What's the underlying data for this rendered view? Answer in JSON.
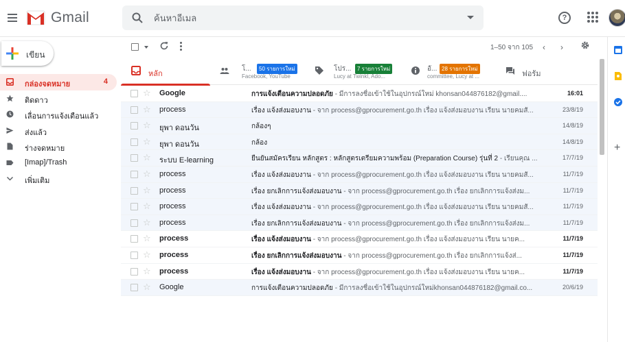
{
  "header": {
    "app_name": "Gmail",
    "search_placeholder": "ค้นหาอีเมล"
  },
  "compose": {
    "label": "เขียน"
  },
  "nav": {
    "items": [
      {
        "label": "กล่องจดหมาย",
        "count": "4",
        "icon": "inbox-icon",
        "active": true
      },
      {
        "label": "ติดดาว",
        "count": "",
        "icon": "star-icon"
      },
      {
        "label": "เลื่อนการแจ้งเตือนแล้ว",
        "count": "",
        "icon": "clock-icon"
      },
      {
        "label": "ส่งแล้ว",
        "count": "",
        "icon": "send-icon"
      },
      {
        "label": "ร่างจดหมาย",
        "count": "",
        "icon": "draft-icon"
      },
      {
        "label": "[Imap]/Trash",
        "count": "",
        "icon": "label-icon"
      },
      {
        "label": "เพิ่มเติม",
        "count": "",
        "icon": "chevron-down-icon"
      }
    ]
  },
  "toolbar": {
    "range": "1–50 จาก 105",
    "prev": "‹",
    "next": "›"
  },
  "tabs": {
    "primary": {
      "title": "หลัก"
    },
    "social": {
      "title": "โ...",
      "badge": "50 รายการใหม่",
      "sub": "Facebook, YouTube",
      "badge_color": "#1a73e8"
    },
    "promotions": {
      "title": "โปร...",
      "badge": "7 รายการใหม่",
      "sub": "Lucy at Twinkl, Ado...",
      "badge_color": "#188038"
    },
    "updates": {
      "title": "อั...",
      "badge": "28 รายการใหม่",
      "sub": "committee, Lucy at ...",
      "badge_color": "#e37400"
    },
    "forums": {
      "title": "ฟอรัม"
    }
  },
  "emails": [
    {
      "sender": "Google",
      "subject": "การแจ้งเตือนความปลอดภัย",
      "snippet": " - มีการลงชื่อเข้าใช้ในอุปกรณ์ใหม่ khonsan044876182@gmail....",
      "date": "16:01",
      "unread": true
    },
    {
      "sender": "process",
      "subject": "เรื่อง แจ้งส่งมอบงาน",
      "snippet": " - จาก process@gprocurement.go.th เรื่อง แจ้งส่งมอบงาน เรียน นายคมสั...",
      "date": "23/8/19",
      "unread": false
    },
    {
      "sender": "ยุพา ดอนวัน",
      "subject": "กล้องๆ",
      "snippet": "",
      "date": "14/8/19",
      "unread": false
    },
    {
      "sender": "ยุพา ดอนวัน",
      "subject": "กล้อง",
      "snippet": "",
      "date": "14/8/19",
      "unread": false
    },
    {
      "sender": "ระบบ E-learning",
      "subject": "ยืนยันสมัครเรียน หลักสูตร : หลักสูตรเตรียมความพร้อม (Preparation Course) รุ่นที่ 2",
      "snippet": " - เรียนคุณ ...",
      "date": "17/7/19",
      "unread": false
    },
    {
      "sender": "process",
      "subject": "เรื่อง แจ้งส่งมอบงาน",
      "snippet": " - จาก process@gprocurement.go.th เรื่อง แจ้งส่งมอบงาน เรียน นายคมสั...",
      "date": "11/7/19",
      "unread": false
    },
    {
      "sender": "process",
      "subject": "เรื่อง ยกเลิกการแจ้งส่งมอบงาน",
      "snippet": " - จาก process@gprocurement.go.th เรื่อง ยกเลิกการแจ้งส่งม...",
      "date": "11/7/19",
      "unread": false
    },
    {
      "sender": "process",
      "subject": "เรื่อง แจ้งส่งมอบงาน",
      "snippet": " - จาก process@gprocurement.go.th เรื่อง แจ้งส่งมอบงาน เรียน นายคมสั...",
      "date": "11/7/19",
      "unread": false
    },
    {
      "sender": "process",
      "subject": "เรื่อง ยกเลิกการแจ้งส่งมอบงาน",
      "snippet": " - จาก process@gprocurement.go.th เรื่อง ยกเลิกการแจ้งส่งม...",
      "date": "11/7/19",
      "unread": false
    },
    {
      "sender": "process",
      "subject": "เรื่อง แจ้งส่งมอบงาน",
      "snippet": " - จาก process@gprocurement.go.th เรื่อง แจ้งส่งมอบงาน เรียน นายค...",
      "date": "11/7/19",
      "unread": true
    },
    {
      "sender": "process",
      "subject": "เรื่อง ยกเลิกการแจ้งส่งมอบงาน",
      "snippet": " - จาก process@gprocurement.go.th เรื่อง ยกเลิกการแจ้งส่...",
      "date": "11/7/19",
      "unread": true
    },
    {
      "sender": "process",
      "subject": "เรื่อง แจ้งส่งมอบงาน",
      "snippet": " - จาก process@gprocurement.go.th เรื่อง แจ้งส่งมอบงาน เรียน นายค...",
      "date": "11/7/19",
      "unread": true
    },
    {
      "sender": "Google",
      "subject": "การแจ้งเตือนความปลอดภัย",
      "snippet": " - มีการลงชื่อเข้าใช้ในอุปกรณ์ใหม่khonsan044876182@gmail.co...",
      "date": "20/6/19",
      "unread": false
    }
  ]
}
